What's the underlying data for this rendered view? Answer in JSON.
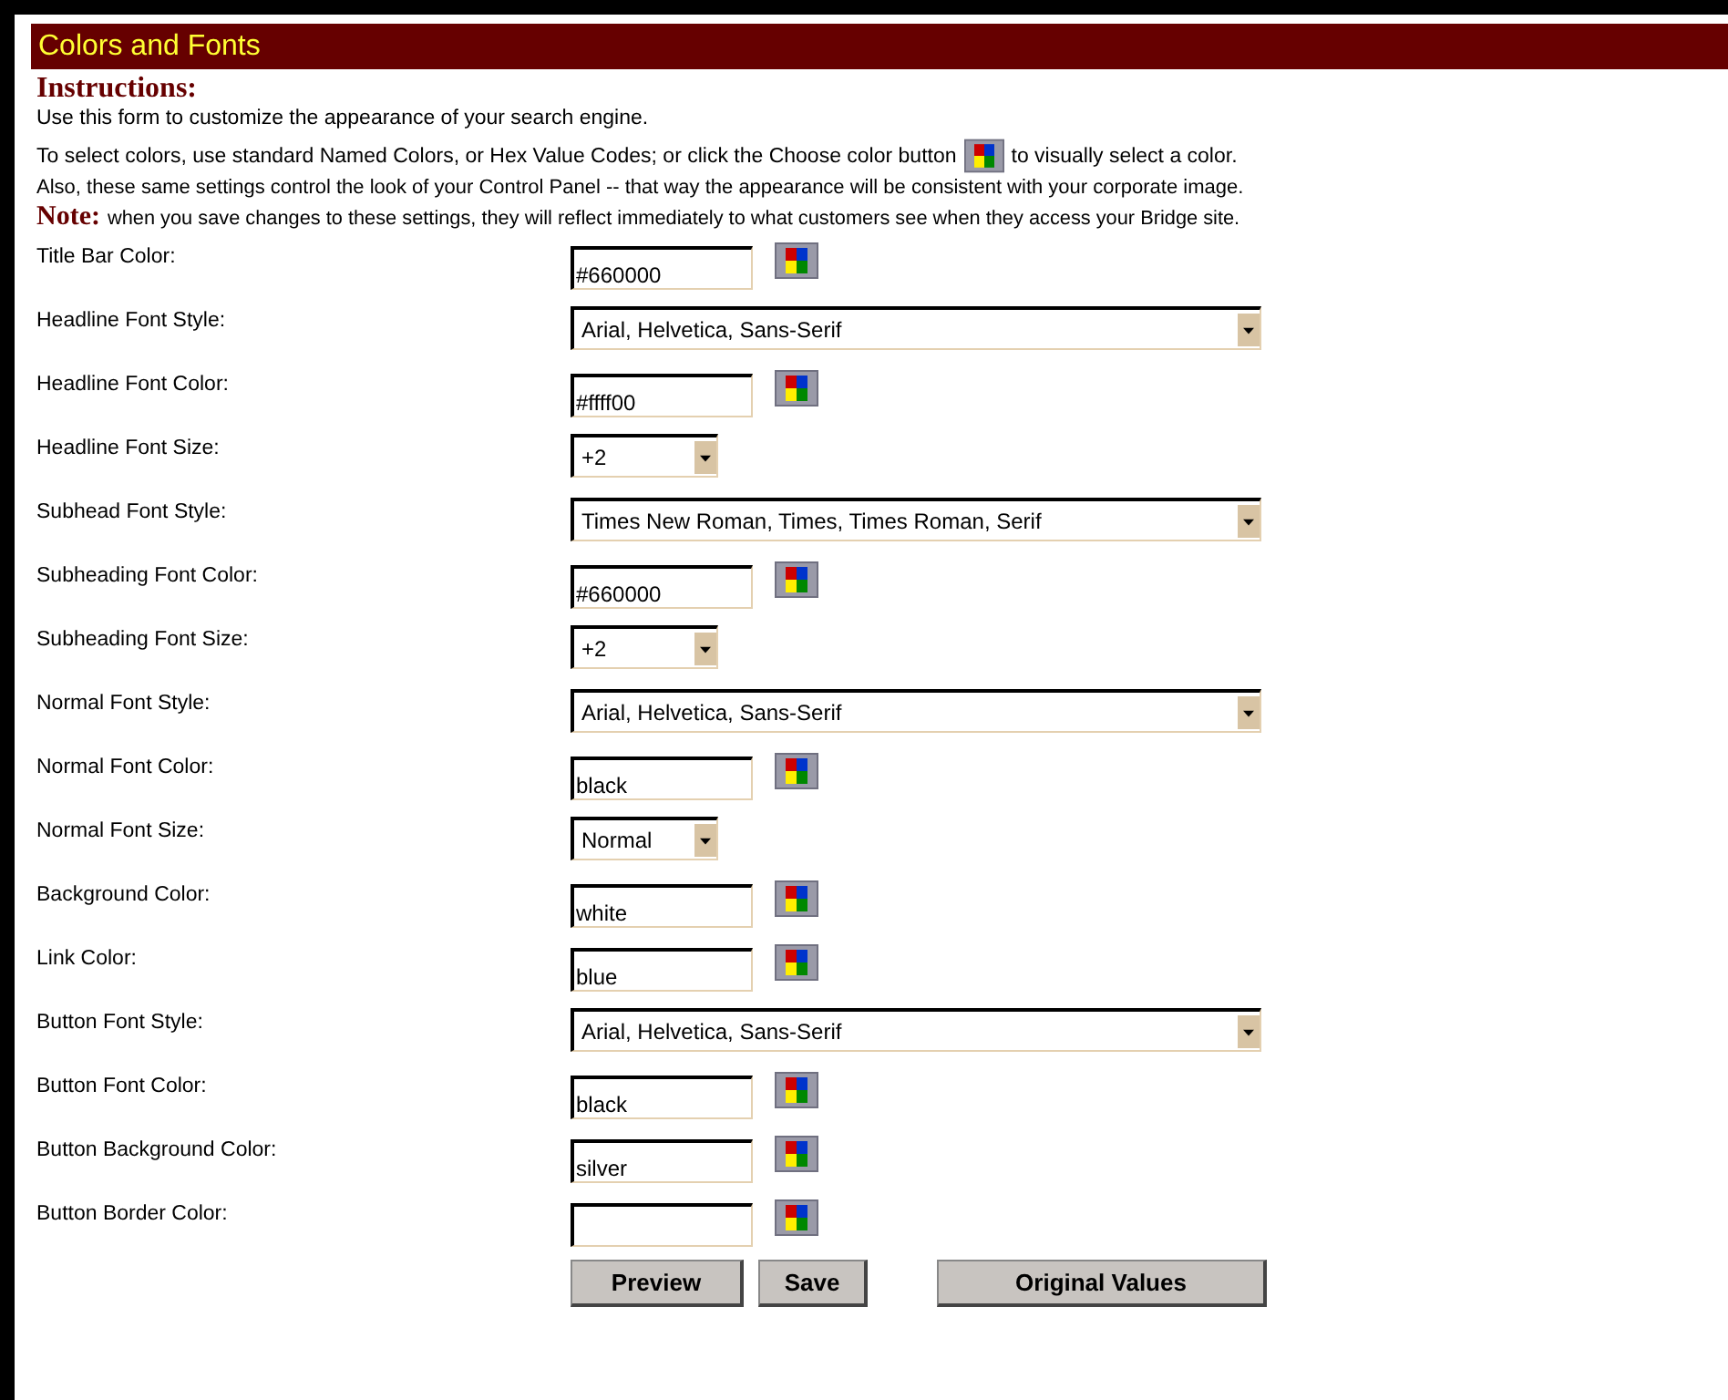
{
  "title_bar": {
    "title": "Colors and Fonts"
  },
  "instructions": {
    "heading": "Instructions:",
    "intro": "Use this form to customize the appearance of your search engine.",
    "color_line_before": "To select colors, use standard Named Colors, or Hex Value Codes; or click the Choose color button",
    "color_line_after": "to visually select a color.",
    "also": "Also, these same settings control the look of your Control Panel -- that way the appearance will be consistent with your corporate image.",
    "note_label": "Note:",
    "note": "when you save changes to these settings, they will reflect immediately to what customers see when they access your Bridge site."
  },
  "fields": [
    {
      "label": "Title Bar Color:",
      "kind": "color",
      "value": "#660000"
    },
    {
      "label": "Headline Font Style:",
      "kind": "select",
      "value": "Arial, Helvetica, Sans-Serif"
    },
    {
      "label": "Headline Font Color:",
      "kind": "color",
      "value": "#ffff00"
    },
    {
      "label": "Headline Font Size:",
      "kind": "size",
      "value": "+2"
    },
    {
      "label": "Subhead Font Style:",
      "kind": "select",
      "value": "Times New Roman, Times, Times Roman, Serif"
    },
    {
      "label": "Subheading Font Color:",
      "kind": "color",
      "value": "#660000"
    },
    {
      "label": "Subheading Font Size:",
      "kind": "size",
      "value": "+2"
    },
    {
      "label": "Normal Font Style:",
      "kind": "select",
      "value": "Arial, Helvetica, Sans-Serif"
    },
    {
      "label": "Normal Font Color:",
      "kind": "color",
      "value": "black"
    },
    {
      "label": "Normal Font Size:",
      "kind": "size",
      "value": "Normal"
    },
    {
      "label": "Background Color:",
      "kind": "color",
      "value": "white"
    },
    {
      "label": "Link Color:",
      "kind": "color",
      "value": "blue"
    },
    {
      "label": "Button Font Style:",
      "kind": "select",
      "value": "Arial, Helvetica, Sans-Serif"
    },
    {
      "label": "Button Font Color:",
      "kind": "color",
      "value": "black"
    },
    {
      "label": "Button Background Color:",
      "kind": "color",
      "value": "silver"
    },
    {
      "label": "Button Border Color:",
      "kind": "color"
    }
  ],
  "buttons": [
    {
      "label": "Preview",
      "kind": "preview"
    },
    {
      "label": "Save",
      "kind": "save"
    },
    {
      "label": "Original Values",
      "kind": "original"
    }
  ]
}
